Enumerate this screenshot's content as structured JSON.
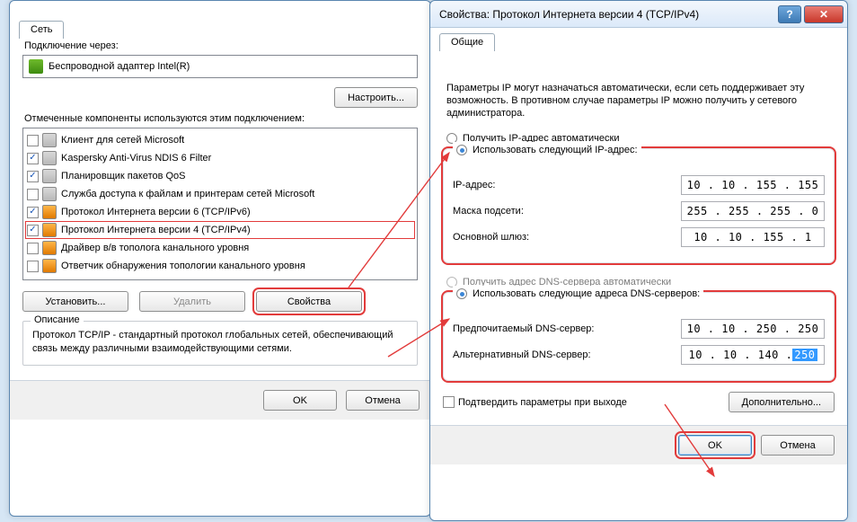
{
  "win1": {
    "tab": "Сеть",
    "connect_label": "Подключение через:",
    "adapter": "Беспроводной адаптер Intel(R)",
    "configure_btn": "Настроить...",
    "components_label": "Отмеченные компоненты используются этим подключением:",
    "items": [
      {
        "checked": false,
        "label": "Клиент для сетей Microsoft"
      },
      {
        "checked": true,
        "label": "Kaspersky Anti-Virus NDIS 6 Filter"
      },
      {
        "checked": true,
        "label": "Планировщик пакетов QoS"
      },
      {
        "checked": false,
        "label": "Служба доступа к файлам и принтерам сетей Microsoft"
      },
      {
        "checked": true,
        "label": "Протокол Интернета версии 6 (TCP/IPv6)"
      },
      {
        "checked": true,
        "label": "Протокол Интернета версии 4 (TCP/IPv4)"
      },
      {
        "checked": false,
        "label": "Драйвер в/в тополога канального уровня"
      },
      {
        "checked": false,
        "label": "Ответчик обнаружения топологии канального уровня"
      }
    ],
    "install_btn": "Установить...",
    "remove_btn": "Удалить",
    "props_btn": "Свойства",
    "desc_legend": "Описание",
    "description": "Протокол TCP/IP - стандартный протокол глобальных сетей, обеспечивающий связь между различными взаимодействующими сетями.",
    "ok_btn": "OK",
    "cancel_btn": "Отмена"
  },
  "win2": {
    "title": "Свойства: Протокол Интернета версии 4 (TCP/IPv4)",
    "tab": "Общие",
    "info": "Параметры IP могут назначаться автоматически, если сеть поддерживает эту возможность. В противном случае параметры IP можно получить у сетевого администратора.",
    "ip_auto": "Получить IP-адрес автоматически",
    "ip_manual": "Использовать следующий IP-адрес:",
    "ip_label": "IP-адрес:",
    "mask_label": "Маска подсети:",
    "gw_label": "Основной шлюз:",
    "ip_value": "10 . 10 . 155 . 155",
    "mask_value": "255 . 255 . 255 .  0",
    "gw_value": "10 . 10 . 155 .  1",
    "dns_auto": "Получить адрес DNS-сервера автоматически",
    "dns_manual": "Использовать следующие адреса DNS-серверов:",
    "dns1_label": "Предпочитаемый DNS-сервер:",
    "dns2_label": "Альтернативный DNS-сервер:",
    "dns1_value": "10 . 10 . 250 . 250",
    "dns2_prefix": "10 . 10 . 140 . ",
    "dns2_sel": "250",
    "confirm": "Подтвердить параметры при выходе",
    "advanced": "Дополнительно...",
    "ok_btn": "OK",
    "cancel_btn": "Отмена"
  }
}
